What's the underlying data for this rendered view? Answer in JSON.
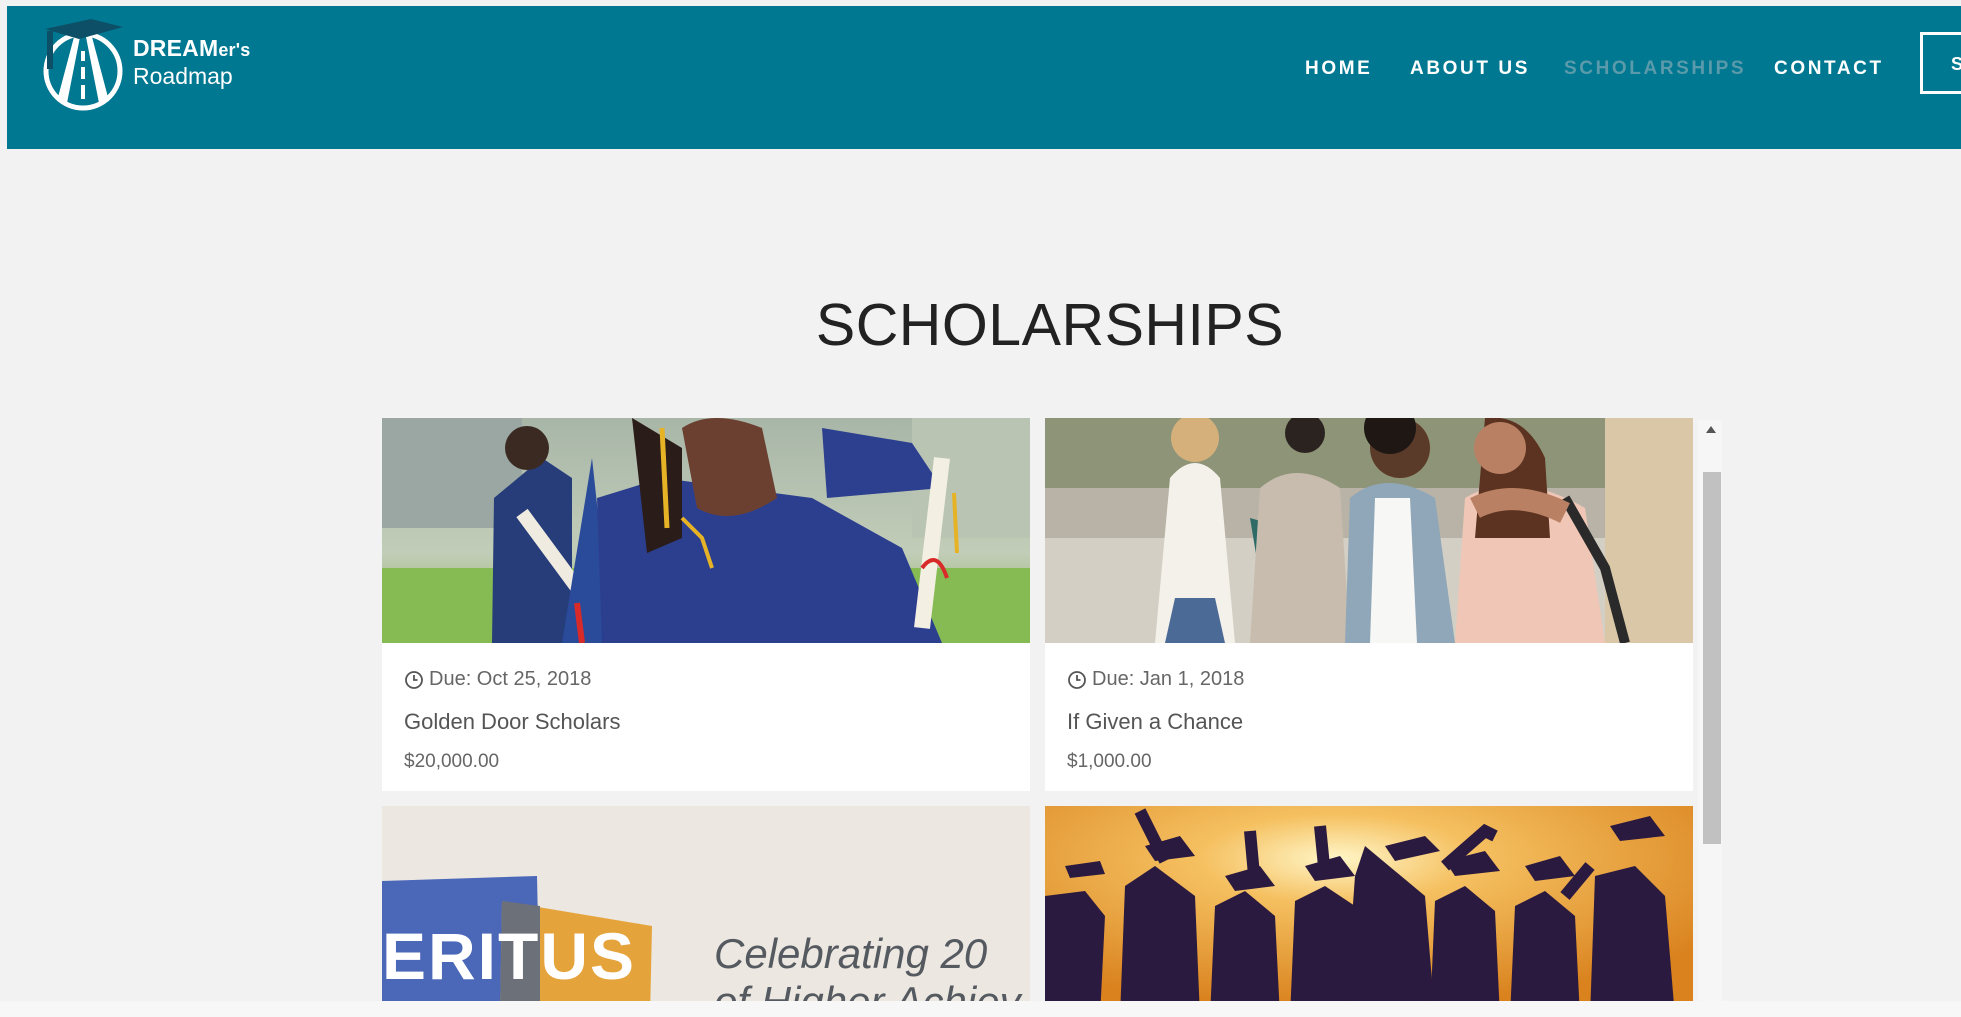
{
  "brand": {
    "name_main": "DREAM",
    "name_suffix": "er's",
    "name_line2": "Roadmap",
    "color": "#007891"
  },
  "nav": {
    "items": [
      {
        "label": "HOME",
        "active": false
      },
      {
        "label": "ABOUT US",
        "active": false
      },
      {
        "label": "SCHOLARSHIPS",
        "active": true
      },
      {
        "label": "CONTACT",
        "active": false
      }
    ],
    "button_label": "S"
  },
  "page": {
    "title": "SCHOLARSHIPS"
  },
  "scholarships": [
    {
      "due": "Due: Oct 25, 2018",
      "name": "Golden Door Scholars",
      "amount": "$20,000.00",
      "image": "graduates-hugging-photo"
    },
    {
      "due": "Due: Jan 1, 2018",
      "name": "If Given a Chance",
      "amount": "$1,000.00",
      "image": "students-group-photo"
    },
    {
      "image": "meritus-banner",
      "banner_logo": "ERITUS",
      "banner_line1": "Celebrating 20",
      "banner_line2": "of Higher Achiev"
    },
    {
      "image": "graduates-silhouette-photo"
    }
  ]
}
